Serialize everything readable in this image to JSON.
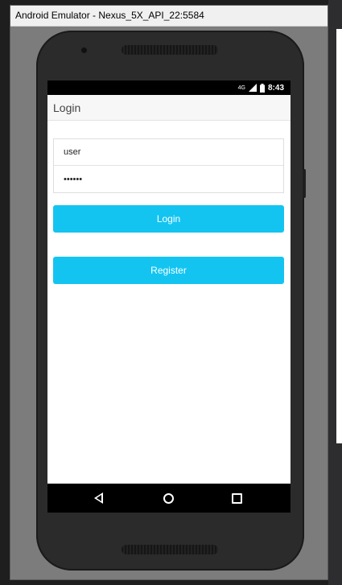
{
  "window": {
    "title": "Android Emulator - Nexus_5X_API_22:5584"
  },
  "status_bar": {
    "network": "4G",
    "time": "8:43"
  },
  "app_bar": {
    "title": "Login"
  },
  "form": {
    "username_value": "user",
    "password_value": "••••••",
    "login_label": "Login",
    "register_label": "Register"
  },
  "colors": {
    "accent": "#13c4f1",
    "status_bar": "#000000",
    "nav_bar": "#000000"
  },
  "icons": {
    "back": "back-icon",
    "home": "home-icon",
    "recents": "recents-icon",
    "signal": "signal-icon",
    "battery": "battery-icon"
  }
}
